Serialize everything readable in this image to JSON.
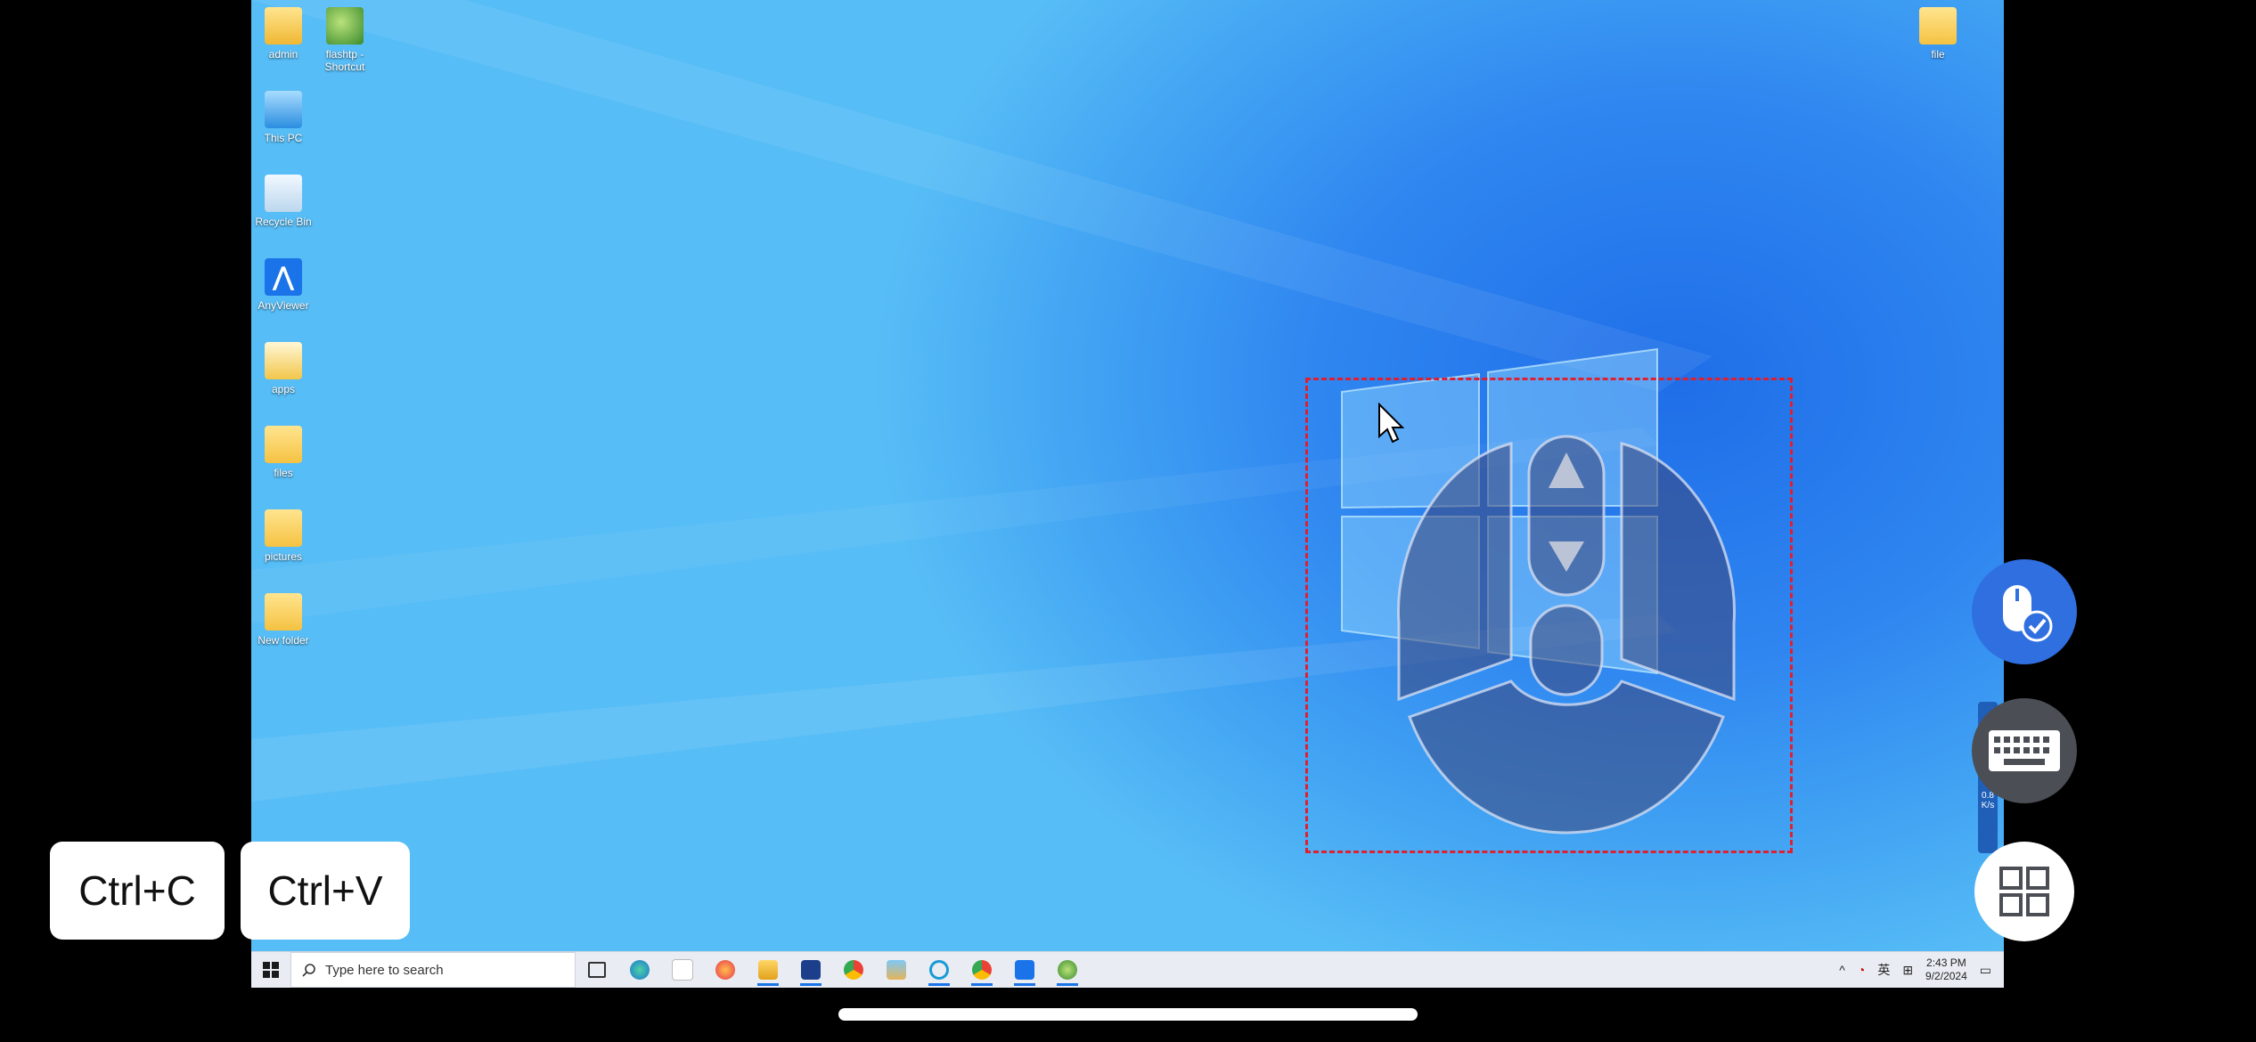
{
  "desktop": {
    "icons_left": [
      {
        "label": "admin"
      },
      {
        "label": "flashtp - Shortcut"
      },
      {
        "label": "This PC"
      },
      {
        "label": "Recycle Bin"
      },
      {
        "label": "AnyViewer"
      },
      {
        "label": "apps"
      },
      {
        "label": "files"
      },
      {
        "label": "pictures"
      },
      {
        "label": "New folder"
      }
    ],
    "icon_right": {
      "label": "file"
    }
  },
  "taskbar": {
    "search_placeholder": "Type here to search",
    "tray": {
      "language": "英",
      "time": "2:43 PM",
      "date": "9/2/2024"
    }
  },
  "shortcuts": {
    "copy": "Ctrl+C",
    "paste": "Ctrl+V"
  },
  "side_strip": {
    "speed_value": "0.8",
    "speed_unit": "K/s"
  },
  "colors": {
    "mouse_button_bg": "#2f6fe0",
    "keyboard_button_bg": "#4b4e55",
    "dashed_border": "#e02030"
  }
}
